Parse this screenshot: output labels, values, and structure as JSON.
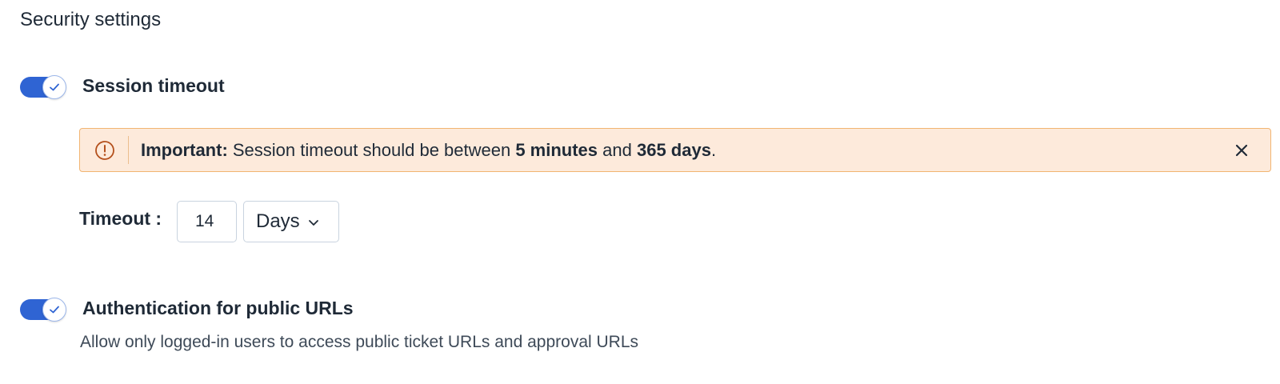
{
  "page": {
    "title": "Security settings"
  },
  "session_timeout": {
    "enabled": true,
    "label": "Session timeout",
    "alert": {
      "prefix": "Important:",
      "text_before": " Session timeout should be between ",
      "min": "5 minutes",
      "conjunction": " and ",
      "max": "365 days",
      "suffix": ".",
      "icon": "exclamation-circle-icon",
      "close_icon": "close-icon",
      "colors": {
        "background": "#fdeadb",
        "border": "#f2b572",
        "icon": "#b4501c"
      }
    },
    "timeout": {
      "label": "Timeout :",
      "value": "14",
      "unit": "Days",
      "unit_icon": "chevron-down-icon"
    }
  },
  "public_url_auth": {
    "enabled": true,
    "label": "Authentication for public URLs",
    "description": "Allow only logged-in users to access public ticket URLs and approval URLs"
  },
  "colors": {
    "toggle_on": "#2f64d3",
    "text": "#1f2a37"
  }
}
